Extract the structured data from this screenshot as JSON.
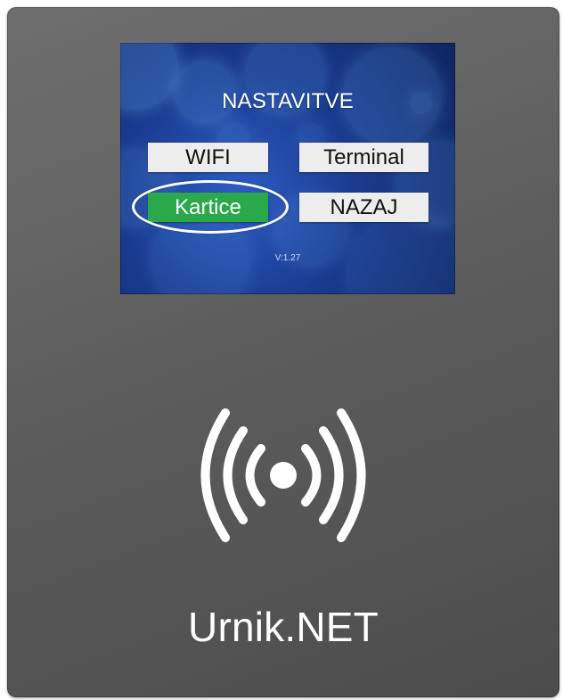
{
  "screen": {
    "title": "NASTAVITVE",
    "buttons": {
      "wifi": "WIFI",
      "terminal": "Terminal",
      "kartice": "Kartice",
      "nazaj": "NAZAJ"
    },
    "version": "V:1.27",
    "colors": {
      "screen_bg": "#1a3b8f",
      "button_bg": "#ededed",
      "selected_button_bg": "#2aa84a",
      "selected_button_text": "#ffffff",
      "highlight_ring": "#ffffff"
    }
  },
  "device": {
    "brand": "Urnik.NET",
    "colors": {
      "body": "#5f5f5f",
      "icon": "#ffffff"
    },
    "icons": {
      "nfc": "nfc-contactless-icon"
    }
  }
}
